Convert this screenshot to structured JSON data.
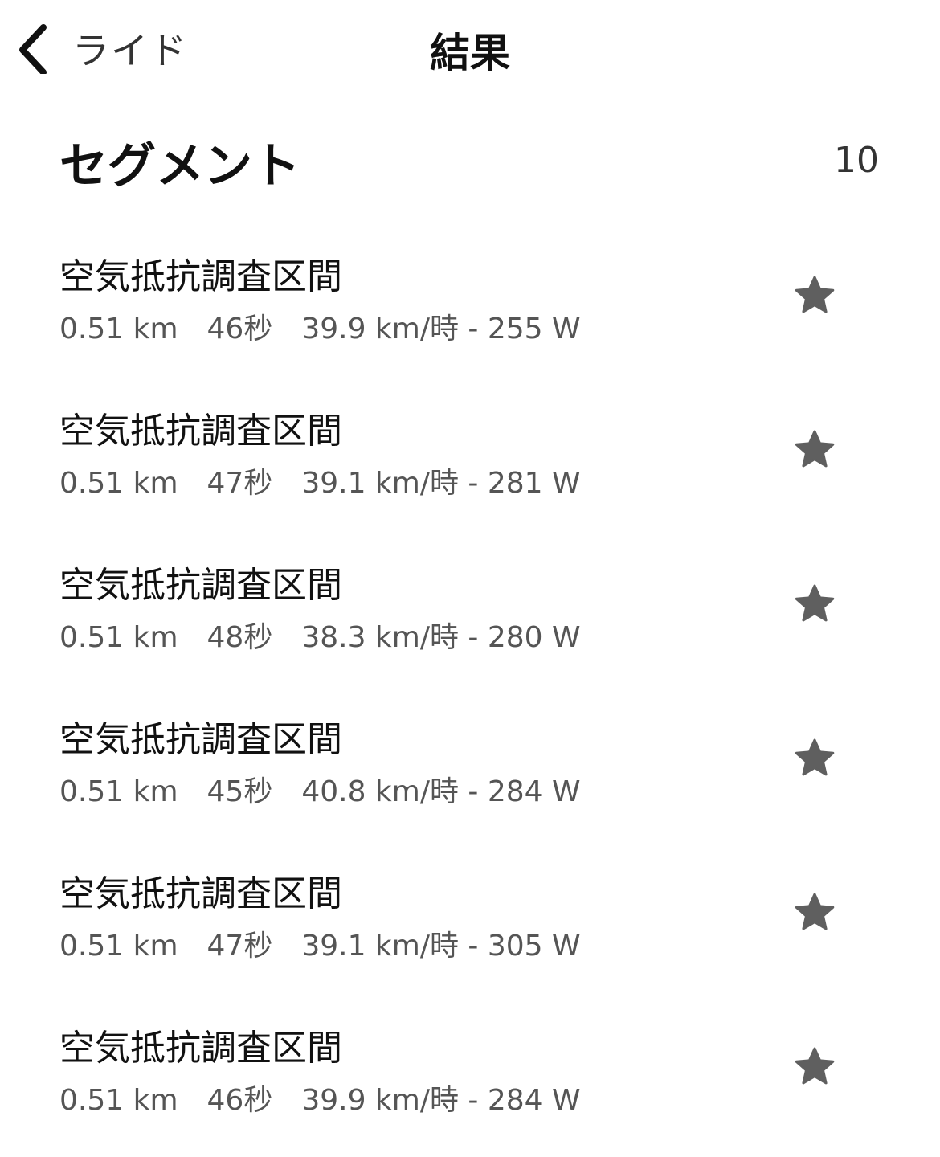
{
  "nav": {
    "back_label": "ライド",
    "title": "結果"
  },
  "section": {
    "title": "セグメント",
    "count": "10"
  },
  "segments": [
    {
      "name": "空気抵抗調査区間",
      "distance": "0.51 km",
      "time": "46秒",
      "speed_power": "39.9 km/時 - 255 W",
      "starred": true
    },
    {
      "name": "空気抵抗調査区間",
      "distance": "0.51 km",
      "time": "47秒",
      "speed_power": "39.1 km/時 - 281 W",
      "starred": true
    },
    {
      "name": "空気抵抗調査区間",
      "distance": "0.51 km",
      "time": "48秒",
      "speed_power": "38.3 km/時 - 280 W",
      "starred": true
    },
    {
      "name": "空気抵抗調査区間",
      "distance": "0.51 km",
      "time": "45秒",
      "speed_power": "40.8 km/時 - 284 W",
      "starred": true
    },
    {
      "name": "空気抵抗調査区間",
      "distance": "0.51 km",
      "time": "47秒",
      "speed_power": "39.1 km/時 - 305 W",
      "starred": true
    },
    {
      "name": "空気抵抗調査区間",
      "distance": "0.51 km",
      "time": "46秒",
      "speed_power": "39.9 km/時 - 284 W",
      "starred": true
    }
  ],
  "colors": {
    "star": "#5f5f5f",
    "text_primary": "#111111",
    "text_secondary": "#555555"
  },
  "icons": {
    "back": "chevron-left-icon",
    "star": "star-icon"
  }
}
